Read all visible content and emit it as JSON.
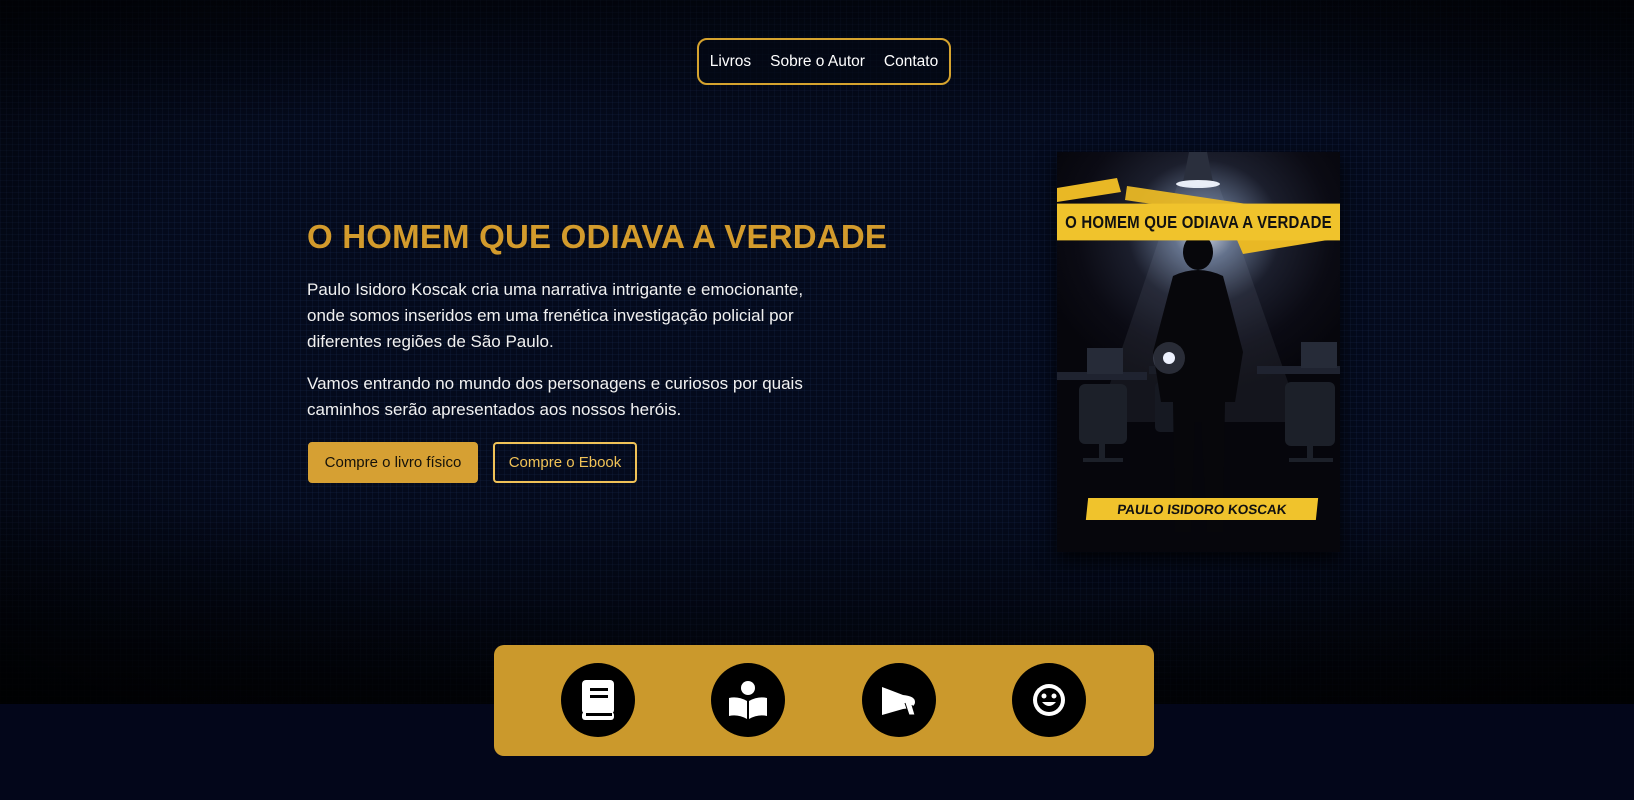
{
  "nav": {
    "items": [
      {
        "label": "Livros"
      },
      {
        "label": "Sobre o Autor"
      },
      {
        "label": "Contato"
      }
    ]
  },
  "hero": {
    "title": "O HOMEM QUE ODIAVA A VERDADE",
    "paragraph1": "Paulo Isidoro Koscak cria uma narrativa intrigante e emocionante, onde somos inseridos em uma frenética investigação policial por diferentes regiões de São Paulo.",
    "paragraph2": "Vamos entrando no mundo dos personagens e curiosos por quais caminhos serão apresentados aos nossos heróis.",
    "buttons": {
      "physical": "Compre o livro físico",
      "ebook": "Compre o Ebook"
    }
  },
  "cover": {
    "title": "O HOMEM QUE ODIAVA A VERDADE",
    "author": "PAULO ISIDORO KOSCAK"
  },
  "features": {
    "icons": [
      "book-icon",
      "reader-icon",
      "megaphone-icon",
      "smiley-icon"
    ]
  },
  "colors": {
    "accent": "#cb992c",
    "title": "#d39b2c",
    "background": "#040a1c",
    "tape": "#f0c32c"
  }
}
